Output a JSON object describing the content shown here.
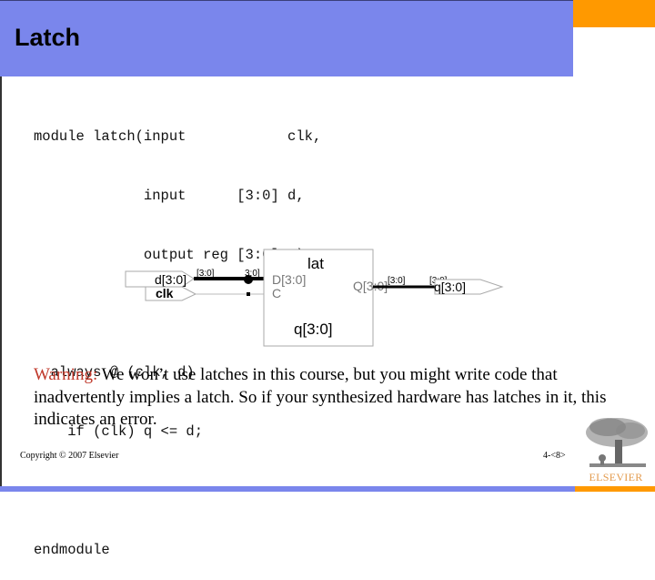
{
  "slide": {
    "title": "Latch",
    "colors": {
      "title_bar": "#7a86ec",
      "accent_orange": "#ff9900",
      "warning": "#c0392b",
      "logo_text": "#e39b4e"
    }
  },
  "code": {
    "lines": [
      "module latch(input            clk,",
      "             input      [3:0] d,",
      "             output reg [3:0] q);",
      "",
      "  always @ (clk, d)",
      "    if (clk) q <= d;",
      "",
      "endmodule"
    ]
  },
  "schematic": {
    "cell_name": "lat",
    "cell_instance": "q[3:0]",
    "pin_d": "D[3:0]",
    "pin_c": "C",
    "pin_q": "Q[3:0]",
    "input_d": "d[3:0]",
    "input_clk": "clk",
    "output_q": "q[3:0]",
    "bus_label_in_1": "[3:0]",
    "bus_label_in_2": "3:0]",
    "bus_label_out_1": "[3:0]",
    "bus_label_out_2": "[3:0]"
  },
  "warning": {
    "label": "Warning:",
    "text": " We won’t use latches in this course, but you might write code that inadvertently implies a latch. So if your synthesized hardware has latches in it, this indicates an error."
  },
  "footer": {
    "copyright": "Copyright © 2007 Elsevier",
    "page_number": "4-<8>",
    "logo_text": "ELSEVIER"
  }
}
